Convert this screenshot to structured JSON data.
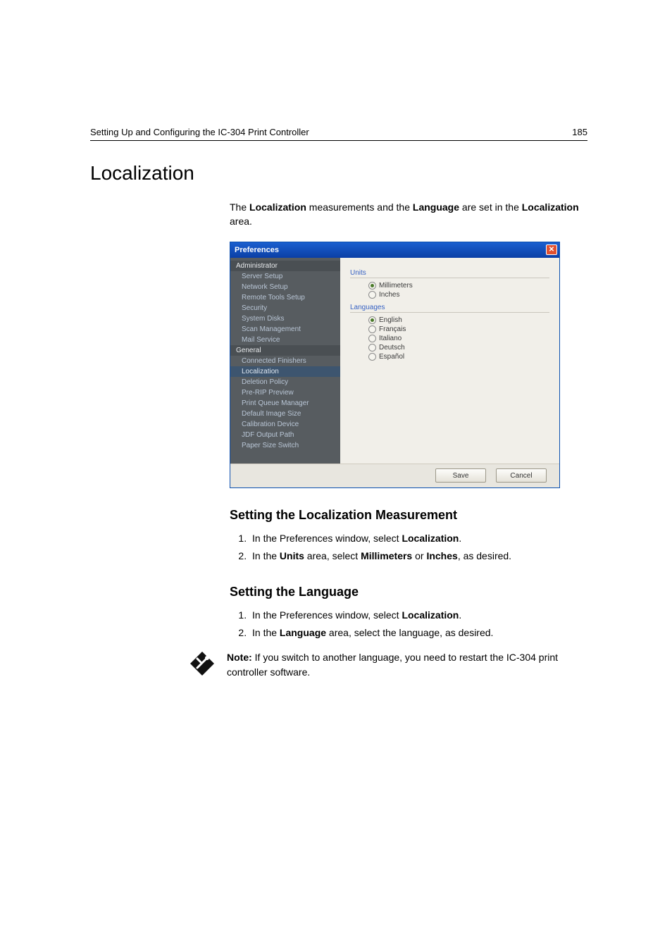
{
  "header": {
    "running": "Setting Up and Configuring the IC-304 Print Controller",
    "pageno": "185"
  },
  "section_title": "Localization",
  "intro": {
    "t1": "The ",
    "b1": "Localization",
    "t2": " measurements and the ",
    "b2": "Language",
    "t3": " are set in the ",
    "b3": "Localization",
    "t4": " area."
  },
  "dialog": {
    "title": "Preferences",
    "close_glyph": "✕",
    "groups": [
      {
        "header": "Administrator",
        "items": [
          "Server Setup",
          "Network Setup",
          "Remote Tools Setup",
          "Security",
          "System Disks",
          "Scan Management",
          "Mail Service"
        ]
      },
      {
        "header": "General",
        "items": [
          "Connected Finishers",
          "Localization",
          "Deletion Policy",
          "Pre-RIP Preview",
          "Print Queue Manager",
          "Default Image Size",
          "Calibration Device",
          "JDF Output Path",
          "Paper Size Switch"
        ]
      }
    ],
    "selected_item": "Localization",
    "units_label": "Units",
    "units_options": [
      {
        "label": "Millimeters",
        "checked": true
      },
      {
        "label": "Inches",
        "checked": false
      }
    ],
    "languages_label": "Languages",
    "language_options": [
      {
        "label": "English",
        "checked": true
      },
      {
        "label": "Français",
        "checked": false
      },
      {
        "label": "Italiano",
        "checked": false
      },
      {
        "label": "Deutsch",
        "checked": false
      },
      {
        "label": "Español",
        "checked": false
      }
    ],
    "save": "Save",
    "cancel": "Cancel"
  },
  "sub1": {
    "heading": "Setting the Localization Measurement",
    "steps": [
      {
        "t1": "In the Preferences window, select ",
        "b1": "Localization",
        "t2": "."
      },
      {
        "t1": "In the ",
        "b1": "Units",
        "t2": " area, select ",
        "b2": "Millimeters",
        "t3": " or ",
        "b3": "Inches",
        "t4": ", as desired."
      }
    ]
  },
  "sub2": {
    "heading": "Setting the Language",
    "steps": [
      {
        "t1": "In the Preferences window, select ",
        "b1": "Localization",
        "t2": "."
      },
      {
        "t1": "In the ",
        "b1": "Language",
        "t2": " area, select the language, as desired."
      }
    ]
  },
  "note": {
    "label": "Note:",
    "text": "  If you switch to another language, you need to restart the IC-304 print controller software."
  }
}
